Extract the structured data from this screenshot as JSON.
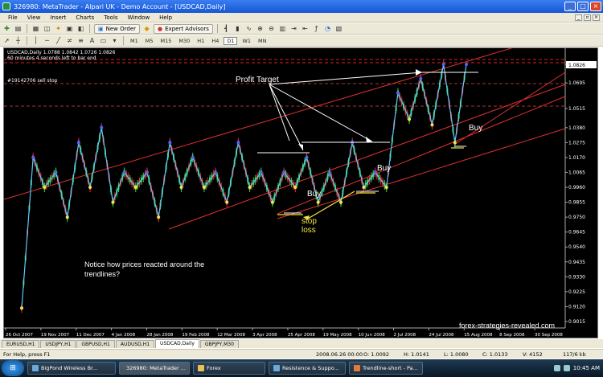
{
  "window": {
    "title": "326980: MetaTrader - Alpari UK - Demo Account - [USDCAD,Daily]"
  },
  "menu": [
    "File",
    "View",
    "Insert",
    "Charts",
    "Tools",
    "Window",
    "Help"
  ],
  "toolbar": {
    "new_order": "New Order",
    "expert_advisors": "Expert Advisors",
    "timeframes": [
      "M1",
      "M5",
      "M15",
      "M30",
      "H1",
      "H4",
      "D1",
      "W1",
      "MN"
    ]
  },
  "chart": {
    "symbol_line": "USDCAD,Daily   1.0788 1.0842 1.0726 1.0826",
    "timer_line": "60 minutes 4 seconds left to bar end",
    "order_label": "#19142706 sell stop",
    "price_box": "1.0826",
    "annotations": {
      "profit_target": "Profit Target",
      "buy": "Buy",
      "stop_loss": "stop loss"
    },
    "note": "Notice how prices reacted around the trendlines?",
    "watermark": "forex-strategies-revealed.com"
  },
  "chart_data": {
    "type": "line",
    "y_ticks": [
      "1.0826",
      "1.0695",
      "1.0515",
      "1.0380",
      "1.0275",
      "1.0170",
      "1.0065",
      "0.9960",
      "0.9855",
      "0.9750",
      "0.9645",
      "0.9540",
      "0.9435",
      "0.9330",
      "0.9225",
      "0.9120",
      "0.9015"
    ],
    "x_ticks": [
      "26 Oct 2007",
      "19 Nov 2007",
      "11 Dec 2007",
      "4 Jan 2008",
      "28 Jan 2008",
      "19 Feb 2008",
      "12 Mar 2008",
      "3 Apr 2008",
      "25 Apr 2008",
      "19 May 2008",
      "10 Jun 2008",
      "2 Jul 2008",
      "24 Jul 2008",
      "15 Aug 2008",
      "8 Sep 2008",
      "30 Sep 2008"
    ],
    "zigzag": [
      0.911,
      1.017,
      0.996,
      1.0065,
      0.975,
      1.0275,
      0.996,
      1.038,
      0.9855,
      1.0065,
      0.996,
      1.0065,
      0.975,
      1.0275,
      0.996,
      1.017,
      0.996,
      1.0065,
      0.9855,
      1.0275,
      0.996,
      1.0065,
      0.9855,
      1.0065,
      0.996,
      1.017,
      0.9855,
      1.0065,
      0.9855,
      1.0275,
      0.996,
      1.0065,
      0.996,
      1.0625,
      1.044,
      1.0725,
      1.04,
      1.0825,
      1.0275,
      1.0825
    ]
  },
  "tabs": [
    "EURUSD,H1",
    "USDJPY,H1",
    "GBPUSD,H1",
    "AUDUSD,H1",
    "USDCAD,Daily",
    "GBPJPY,M30"
  ],
  "active_tab": "USDCAD,Daily",
  "status": {
    "help": "For Help, press F1",
    "date": "2008.06.26 00:00",
    "open": "O: 1.0092",
    "high": "H: 1.0141",
    "low": "L: 1.0080",
    "close": "C: 1.0133",
    "volume": "V: 4152",
    "traffic": "117/6 kb"
  },
  "taskbar": {
    "items": [
      "BigPond Wireless Br...",
      "326980: MetaTrader ...",
      "Forex",
      "Resistence & Suppo...",
      "Trendline-short - Pa..."
    ],
    "clock": "10:45 AM"
  }
}
